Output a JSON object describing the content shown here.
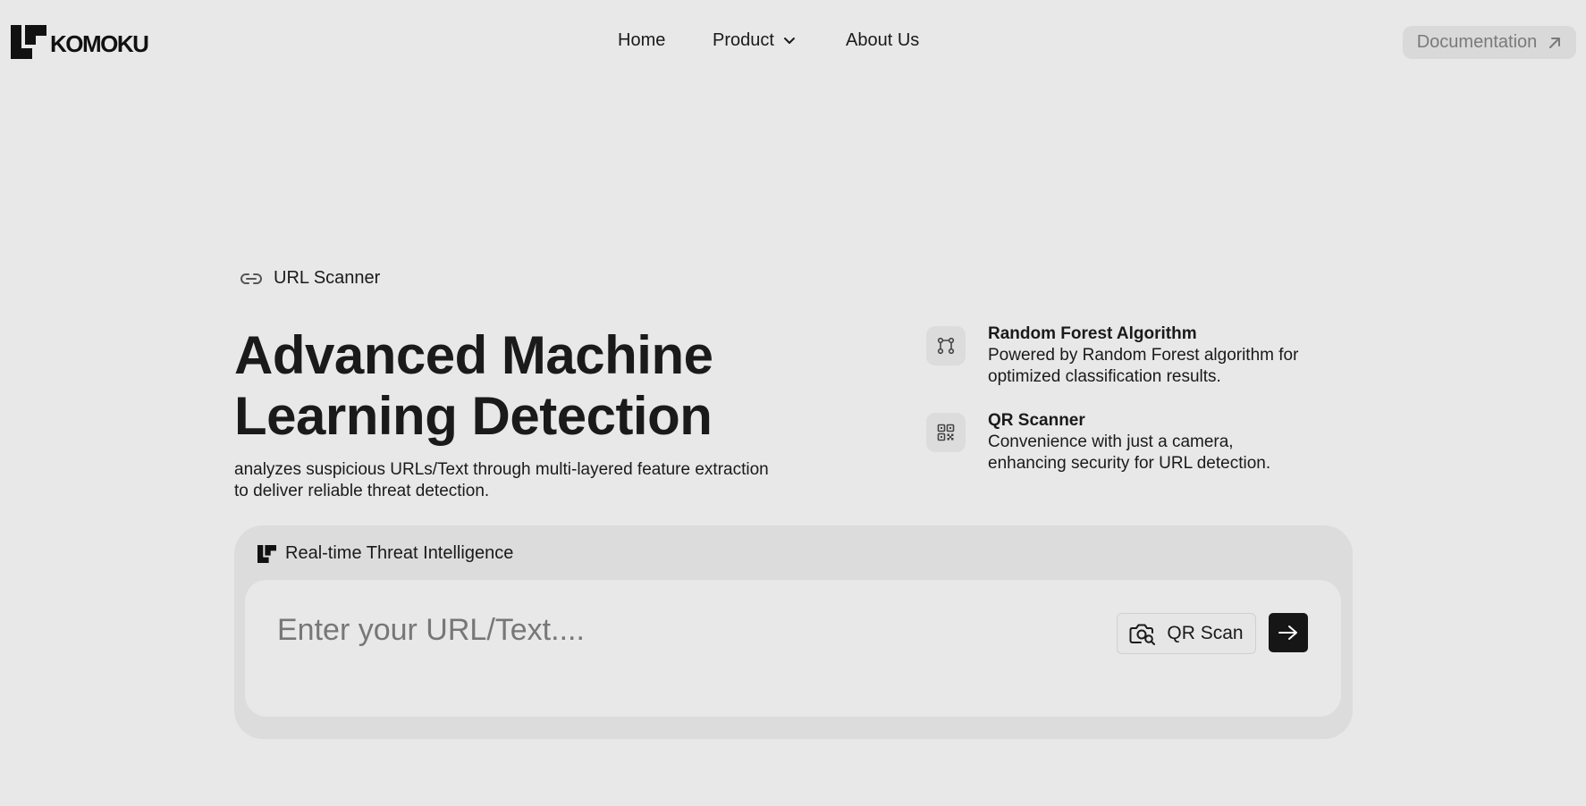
{
  "header": {
    "logo_text": "KOMOKU",
    "nav": {
      "home": "Home",
      "product": "Product",
      "about": "About Us"
    },
    "documentation_label": "Documentation"
  },
  "badge": {
    "label": "URL Scanner",
    "icon": "link-icon"
  },
  "hero": {
    "title_line1": "Advanced Machine",
    "title_line2": "Learning Detection",
    "description_line1": "analyzes suspicious URLs/Text through multi-layered feature extraction",
    "description_line2": "to deliver reliable threat detection."
  },
  "features": [
    {
      "icon": "workflow-icon",
      "title": "Random Forest Algorithm",
      "desc_line1": "Powered by Random Forest algorithm for",
      "desc_line2": "optimized classification results."
    },
    {
      "icon": "qr-code-icon",
      "title": "QR Scanner",
      "desc_line1": "Convenience with just a camera,",
      "desc_line2": "enhancing security for URL detection."
    }
  ],
  "scanner": {
    "heading": "Real-time Threat Intelligence",
    "input_placeholder": "Enter your URL/Text....",
    "input_value": "",
    "qr_button": "QR Scan",
    "submit_icon": "arrow-right-icon"
  },
  "colors": {
    "background": "#e8e8e8",
    "card": "#dcdcdc",
    "primary_dark": "#161616",
    "muted_text": "#7a7a7a"
  }
}
